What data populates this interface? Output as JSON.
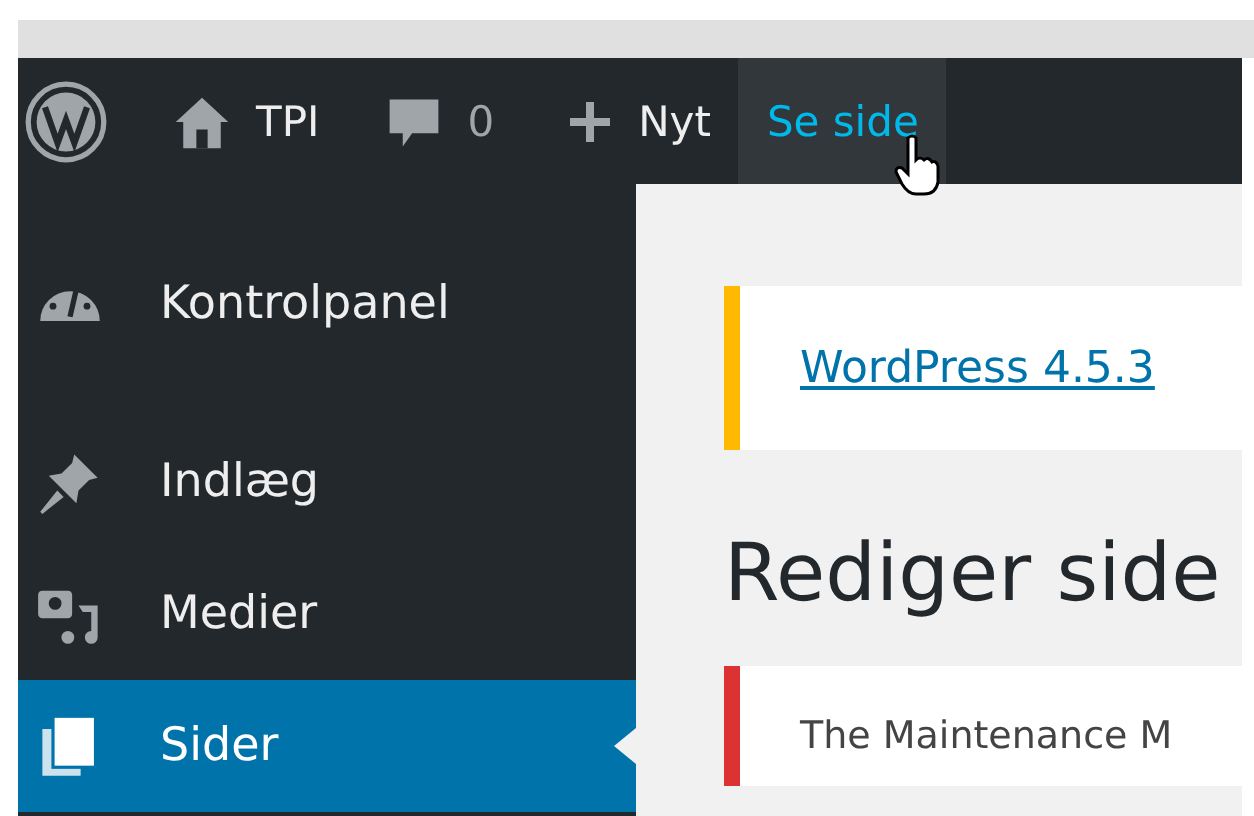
{
  "admin_bar": {
    "items": [
      {
        "hover": false
      },
      {
        "label": "TPI",
        "hover": false
      },
      {
        "label": "0",
        "hover": false
      },
      {
        "label": "Nyt",
        "hover": false
      },
      {
        "label": "Se side",
        "hover": true
      }
    ]
  },
  "sidebar": {
    "items": [
      {
        "label": "Kontrolpanel",
        "selected": false
      },
      {
        "label": "Indlæg",
        "selected": false
      },
      {
        "label": "Medier",
        "selected": false
      },
      {
        "label": "Sider",
        "selected": true
      }
    ]
  },
  "update_notice": {
    "link": "WordPress 4.5.3"
  },
  "heading": "Rediger side",
  "error_notice": {
    "text": "The Maintenance M"
  }
}
